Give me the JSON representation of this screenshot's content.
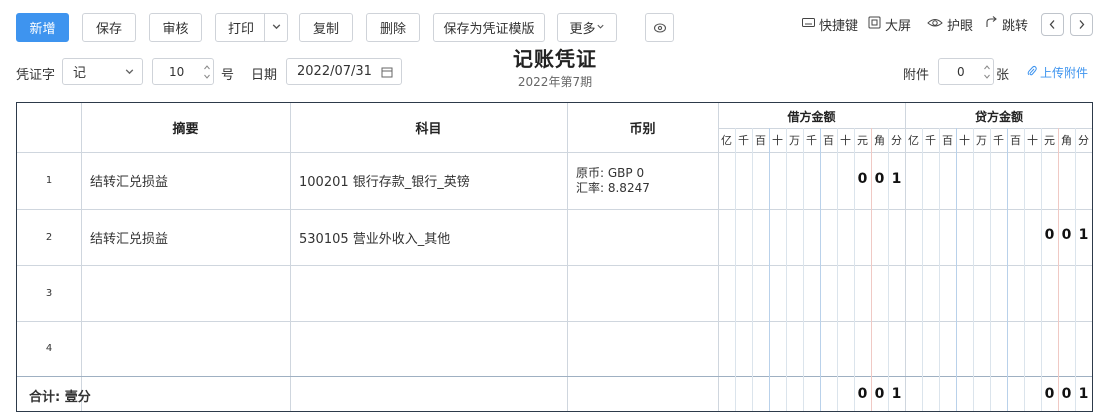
{
  "toolbar": {
    "new": "新增",
    "save": "保存",
    "review": "审核",
    "print": "打印",
    "copy": "复制",
    "delete": "删除",
    "save_template": "保存为凭证模版",
    "more": "更多",
    "shortcuts": "快捷键",
    "fullscreen": "大屏",
    "eye_protect": "护眼",
    "jump": "跳转"
  },
  "form": {
    "voucher_word_label": "凭证字",
    "voucher_word_value": "记",
    "number_value": "10",
    "number_suffix": "号",
    "date_label": "日期",
    "date_value": "2022/07/31",
    "title": "记账凭证",
    "period": "2022年第7期",
    "attach_label": "附件",
    "attach_value": "0",
    "attach_unit": "张",
    "upload": "上传附件"
  },
  "table": {
    "headers": {
      "summary": "摘要",
      "account": "科目",
      "currency": "币别",
      "debit": "借方金额",
      "credit": "贷方金额"
    },
    "digit_units": [
      "亿",
      "千",
      "百",
      "十",
      "万",
      "千",
      "百",
      "十",
      "元",
      "角",
      "分"
    ],
    "rows": [
      {
        "no": "1",
        "summary": "结转汇兑损益",
        "account": "100201  银行存款_银行_英镑",
        "currency_line1": "原币:  GBP 0",
        "currency_line2": "汇率:  8.8247",
        "debit": [
          "0",
          "0",
          "1"
        ],
        "credit": [
          "",
          "",
          ""
        ]
      },
      {
        "no": "2",
        "summary": "结转汇兑损益",
        "account": "530105  营业外收入_其他",
        "currency_line1": "",
        "currency_line2": "",
        "debit": [
          "",
          "",
          ""
        ],
        "credit": [
          "0",
          "0",
          "1"
        ]
      },
      {
        "no": "3",
        "summary": "",
        "account": "",
        "currency_line1": "",
        "currency_line2": "",
        "debit": [
          "",
          "",
          ""
        ],
        "credit": [
          "",
          "",
          ""
        ]
      },
      {
        "no": "4",
        "summary": "",
        "account": "",
        "currency_line1": "",
        "currency_line2": "",
        "debit": [
          "",
          "",
          ""
        ],
        "credit": [
          "",
          "",
          ""
        ]
      }
    ],
    "total_label": "合计: 壹分",
    "total_debit": [
      "0",
      "0",
      "1"
    ],
    "total_credit": [
      "0",
      "0",
      "1"
    ]
  }
}
